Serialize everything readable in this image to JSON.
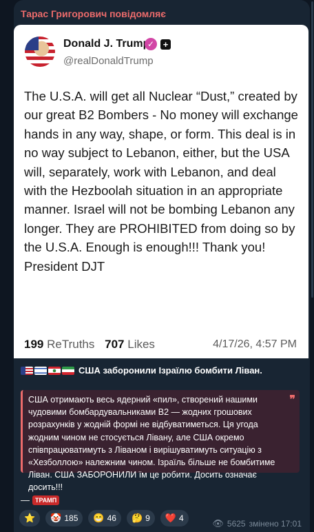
{
  "message": {
    "author": "Тарас Григорович повідомляє"
  },
  "post": {
    "name": "Donald J. Trump",
    "handle": "@realDonaldTrump",
    "text": "The U.S.A. will get all Nuclear “Dust,” created by our great B2 Bombers - No money will exchange hands in any way, shape, or form. This deal is in no way subject to Lebanon, either, but the USA will, separately, work with Lebanon, and deal with the Hezboolah situation in an appropriate manner. Israel will not be bombing Lebanon any longer. They are PROHIBITED from doing so by the U.S.A. Enough is enough!!! Thank you! President DJT",
    "retruths_count": "199",
    "retruths_label": "ReTruths",
    "likes_count": "707",
    "likes_label": "Likes",
    "timestamp": "4/17/26, 4:57 PM"
  },
  "headline": {
    "text": "США заборонили Ізраїлю бомбити Ліван.",
    "flags": [
      "us-flag",
      "israel-flag",
      "lebanon-flag",
      "iran-flag"
    ]
  },
  "quote": {
    "text": "США отримають весь ядерний «пил», створений нашими чудовими бомбардувальниками B2 — жодних грошових розрахунків у жодній формі не відбуватиметься. Ця угода жодним чином не стосується Лівану, але США окремо співпрацюватимуть з Ліваном і вирішуватимуть ситуацію з «Хезболлою» належним чином. Ізраїль більше не бомбитиме Ліван. США ЗАБОРОНИЛИ їм це робити. Досить означає досить!!!"
  },
  "signature": {
    "dash": "—",
    "badge": "ТРАМП"
  },
  "reactions": [
    {
      "icon": "star-icon",
      "glyph": "⭐",
      "count": ""
    },
    {
      "icon": "clown-icon",
      "glyph": "🤡",
      "count": "185"
    },
    {
      "icon": "grin-icon",
      "glyph": "😁",
      "count": "46"
    },
    {
      "icon": "thinking-icon",
      "glyph": "🤔",
      "count": "9"
    },
    {
      "icon": "heart-icon",
      "glyph": "❤️",
      "count": "4"
    }
  ],
  "meta": {
    "views": "5625",
    "edited_time": "змінено 17:01"
  },
  "colors": {
    "accent": "#ec6b6b",
    "bubble": "#182533",
    "background": "#0e1621"
  }
}
